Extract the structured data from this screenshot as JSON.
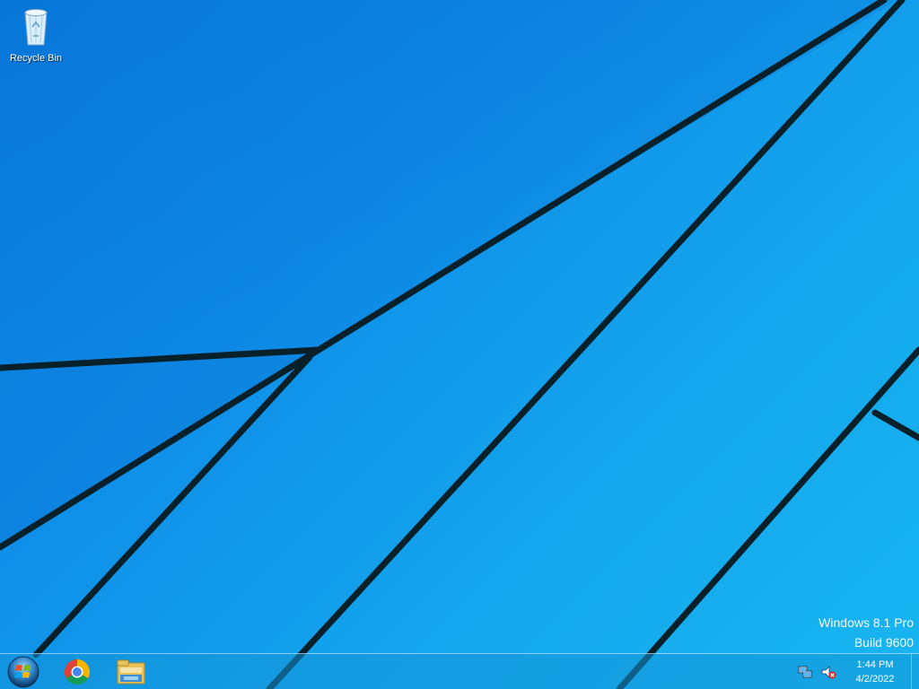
{
  "desktop": {
    "icons": [
      {
        "label": "Recycle Bin",
        "icon": "recycle-bin-icon"
      }
    ],
    "watermark": {
      "line1": "Windows 8.1 Pro",
      "line2": "Build 9600"
    },
    "wallpaper_color": "#0f8fe9"
  },
  "taskbar": {
    "start_icon": "windows-start-orb-icon",
    "pinned": [
      {
        "name": "Google Chrome",
        "icon": "chrome-icon"
      },
      {
        "name": "File Explorer",
        "icon": "file-explorer-icon"
      }
    ],
    "tray": {
      "icons": [
        "network-icon",
        "volume-muted-icon"
      ],
      "time": "1:44 PM",
      "date": "4/2/2022"
    }
  }
}
